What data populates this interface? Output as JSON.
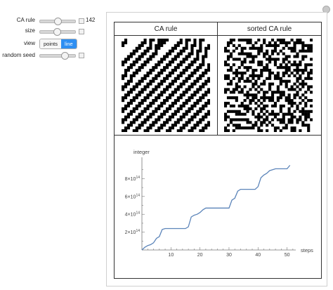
{
  "controls": {
    "ca_rule": {
      "label": "CA rule",
      "value": "142",
      "fraction": 0.52
    },
    "size": {
      "label": "size",
      "fraction": 0.5
    },
    "view": {
      "label": "view",
      "options": [
        "points",
        "line"
      ],
      "selected": "line"
    },
    "random_seed": {
      "label": "random seed",
      "fraction": 0.72
    }
  },
  "panel": {
    "headers": [
      "CA rule",
      "sorted CA rule"
    ],
    "plot": {
      "y_axis_label": "integer",
      "x_axis_label": "steps",
      "y_ticks": [
        {
          "mantissa": "2",
          "exp": "14",
          "value": 200000000000000.0
        },
        {
          "mantissa": "4",
          "exp": "14",
          "value": 400000000000000.0
        },
        {
          "mantissa": "6",
          "exp": "14",
          "value": 600000000000000.0
        },
        {
          "mantissa": "8",
          "exp": "14",
          "value": 800000000000000.0
        }
      ],
      "x_ticks": [
        "10",
        "20",
        "30",
        "40",
        "50"
      ]
    }
  },
  "chart_data": {
    "type": "line",
    "x_axis_label": "steps",
    "y_axis_label": "integer",
    "xlim": [
      0,
      53
    ],
    "ylim": [
      0,
      1000000000000000.0
    ],
    "color": "#5b84b9",
    "x": [
      0,
      1,
      2,
      3,
      4,
      5,
      6,
      7,
      8,
      9,
      10,
      11,
      12,
      13,
      14,
      15,
      16,
      17,
      18,
      19,
      20,
      21,
      22,
      23,
      24,
      25,
      26,
      27,
      28,
      29,
      30,
      31,
      32,
      33,
      34,
      35,
      36,
      37,
      38,
      39,
      40,
      41,
      42,
      43,
      44,
      45,
      46,
      47,
      48,
      49,
      50,
      51
    ],
    "y": [
      0,
      30000000000000.0,
      50000000000000.0,
      60000000000000.0,
      80000000000000.0,
      130000000000000.0,
      150000000000000.0,
      230000000000000.0,
      240000000000000.0,
      240000000000000.0,
      240000000000000.0,
      240000000000000.0,
      240000000000000.0,
      240000000000000.0,
      240000000000000.0,
      240000000000000.0,
      260000000000000.0,
      370000000000000.0,
      390000000000000.0,
      400000000000000.0,
      420000000000000.0,
      450000000000000.0,
      470000000000000.0,
      470000000000000.0,
      470000000000000.0,
      470000000000000.0,
      470000000000000.0,
      470000000000000.0,
      470000000000000.0,
      470000000000000.0,
      470000000000000.0,
      560000000000000.0,
      580000000000000.0,
      660000000000000.0,
      680000000000000.0,
      680000000000000.0,
      680000000000000.0,
      680000000000000.0,
      680000000000000.0,
      680000000000000.0,
      710000000000000.0,
      810000000000000.0,
      840000000000000.0,
      860000000000000.0,
      890000000000000.0,
      900000000000000.0,
      910000000000000.0,
      910000000000000.0,
      910000000000000.0,
      910000000000000.0,
      910000000000000.0,
      950000000000000.0
    ]
  }
}
